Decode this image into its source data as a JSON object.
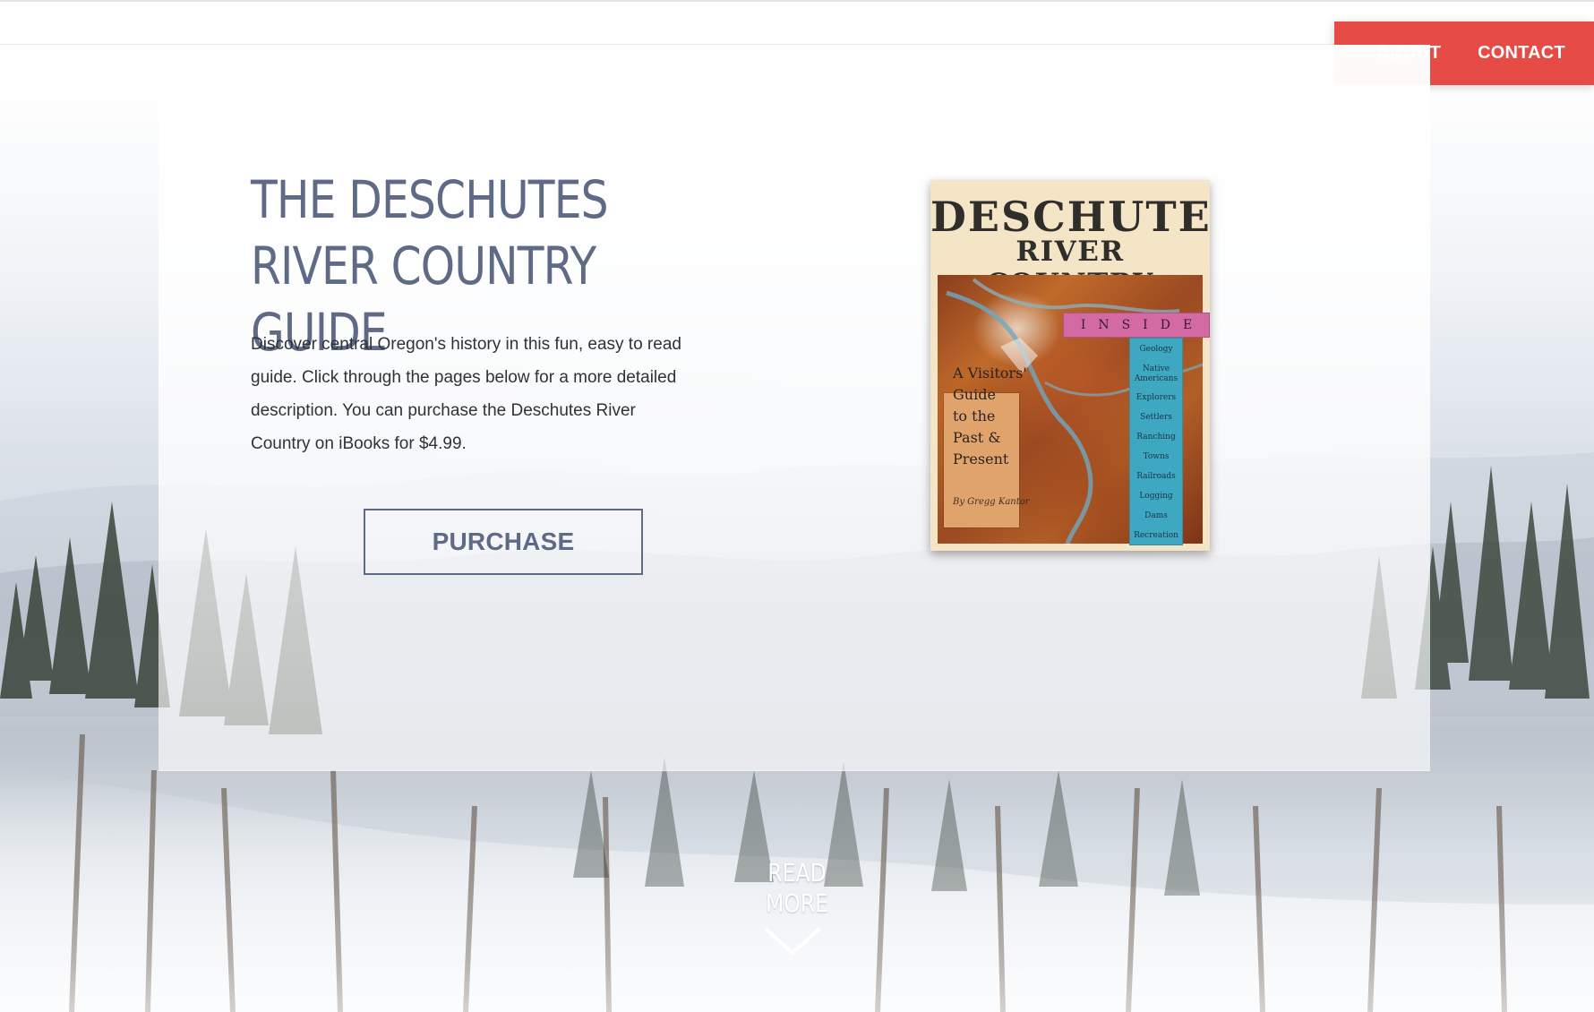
{
  "nav": {
    "items": [
      {
        "label": "ABOUT"
      },
      {
        "label": "CONTACT"
      }
    ],
    "accent": "#e64c45"
  },
  "hero": {
    "title": "THE DESCHUTES RIVER COUNTRY GUIDE",
    "description": "Discover central Oregon's history in this fun, easy to read guide. Click through the pages below for a more detailed description. You can purchase the Deschutes River Country on iBooks for $4.99.",
    "purchase_label": "PURCHASE",
    "title_color": "#5e6a86"
  },
  "book": {
    "title_line1": "DESCHUTES",
    "title_line2": "RIVER COUNTRY",
    "inside_label": "INSIDE",
    "topics": [
      "Geology",
      "Native Americans",
      "Explorers",
      "Settlers",
      "Ranching",
      "Towns",
      "Railroads",
      "Logging",
      "Dams",
      "Recreation"
    ],
    "visitors_text": "A Visitors'\nGuide\nto the\nPast &\nPresent",
    "author": "By Gregg Kantor"
  },
  "readmore": {
    "label": "READ MORE"
  },
  "icons": {
    "chevron": "chevron-down-icon"
  }
}
